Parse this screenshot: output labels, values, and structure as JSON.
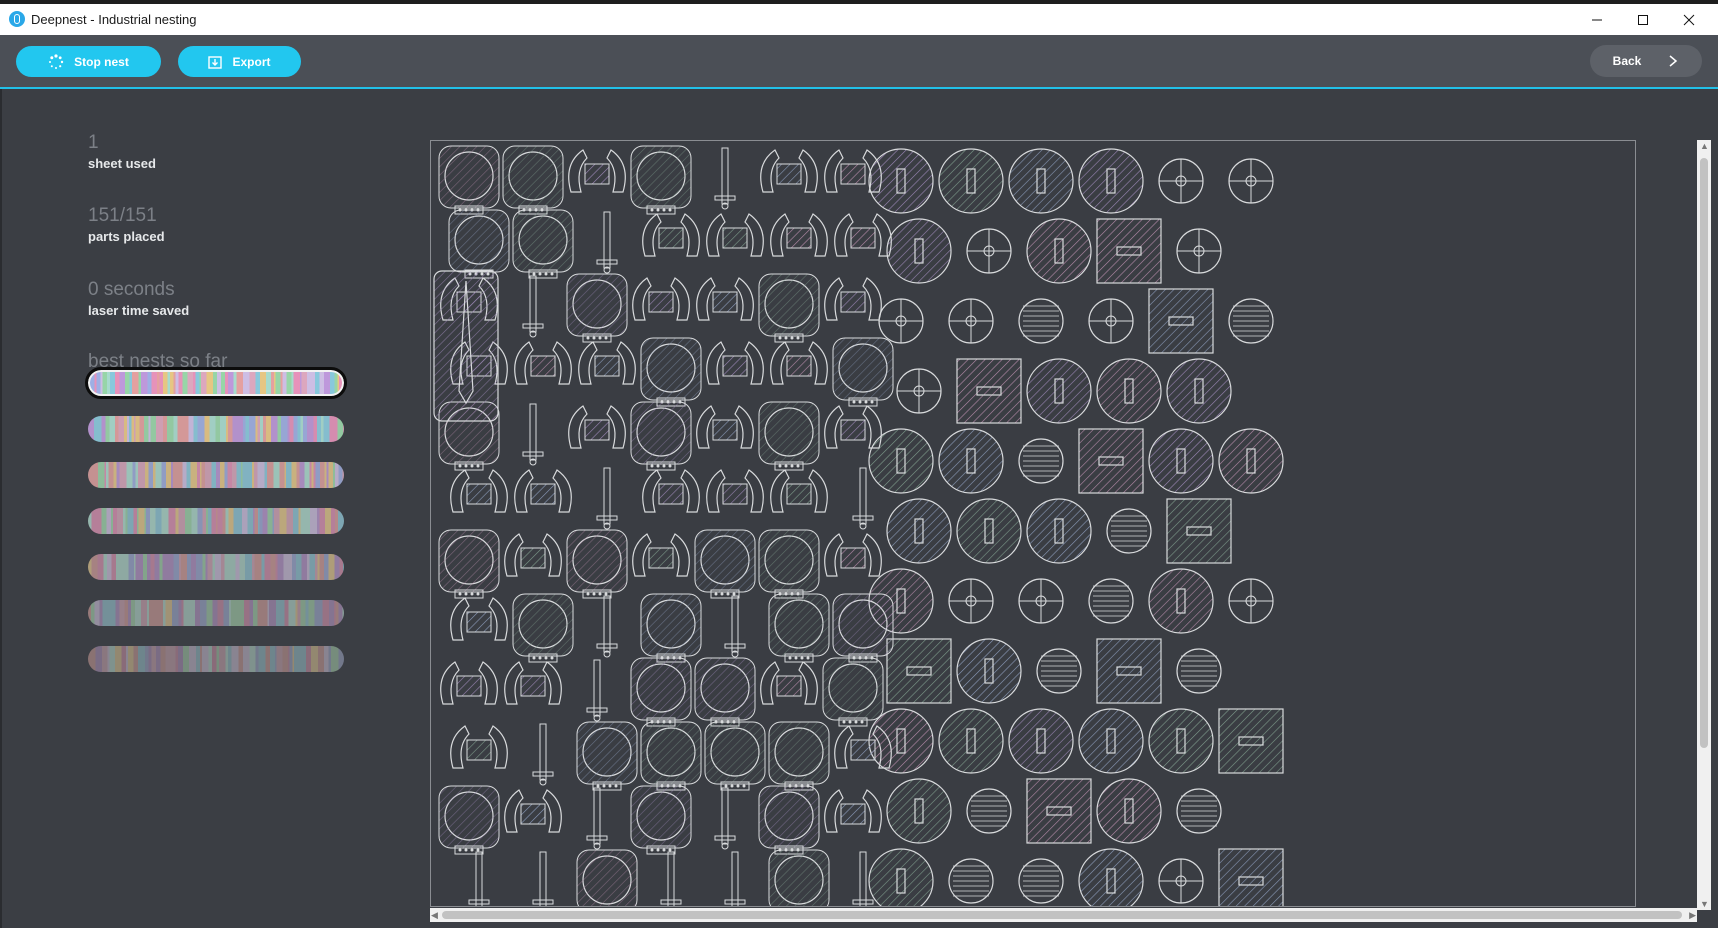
{
  "window": {
    "title": "Deepnest - Industrial nesting"
  },
  "toolbar": {
    "stop_label": "Stop nest",
    "export_label": "Export",
    "back_label": "Back"
  },
  "stats": [
    {
      "value": "1",
      "label": "sheet used"
    },
    {
      "value": "151/151",
      "label": "parts placed"
    },
    {
      "value": "0 seconds",
      "label": "laser time saved"
    }
  ],
  "best_nests": {
    "title": "best nests so far",
    "count": 7,
    "selected_index": 0
  },
  "colors": {
    "accent": "#22c7ef",
    "background": "#3b3e44",
    "toolbar": "#4b4f56"
  },
  "icons": [
    "app-logo-icon",
    "minimize-icon",
    "maximize-icon",
    "close-icon",
    "spinner-icon",
    "export-icon",
    "chevron-right-icon"
  ]
}
